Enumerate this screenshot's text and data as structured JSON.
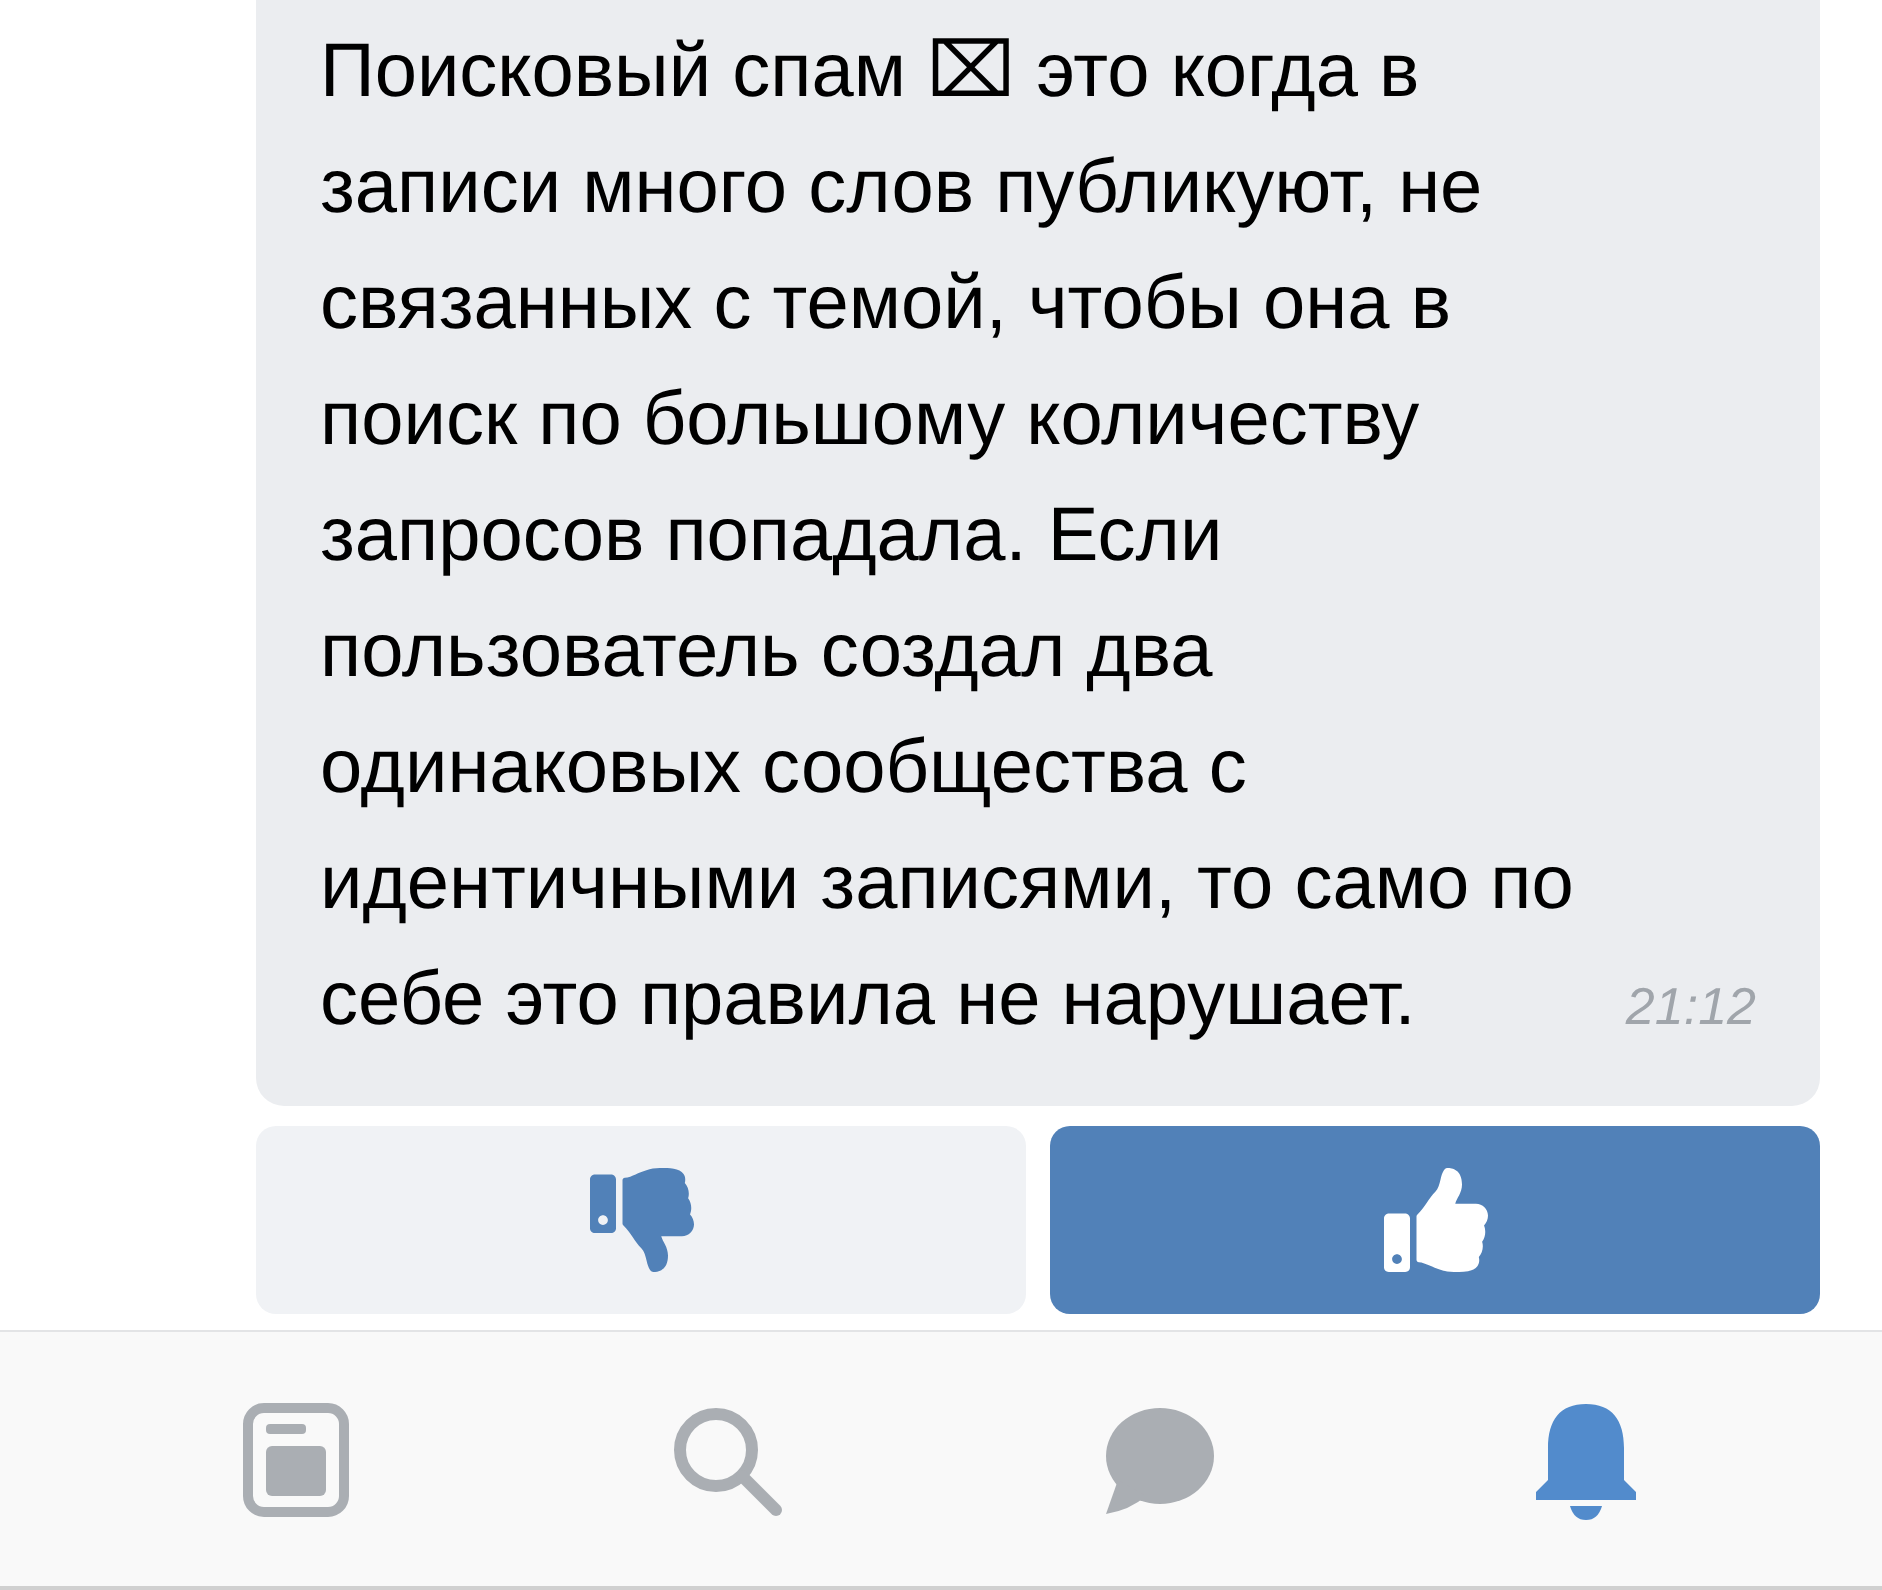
{
  "message": {
    "text": "Поисковый спам ⌧ это когда в\nзаписи много слов публикуют, не\nсвязанных с темой, чтобы она в\nпоиск по большому количеству\nзапросов попадала. Если\nпользователь создал два\nодинаковых сообщества с\nидентичными записями, то само по\nсебе это правила не нарушает.",
    "time": "21:12"
  },
  "reactions": [
    {
      "kind": "dislike",
      "selected": false
    },
    {
      "kind": "like",
      "selected": true
    }
  ],
  "nav": [
    {
      "kind": "feed",
      "selected": false
    },
    {
      "kind": "search",
      "selected": false
    },
    {
      "kind": "messages",
      "selected": false
    },
    {
      "kind": "notifications",
      "selected": true
    }
  ]
}
